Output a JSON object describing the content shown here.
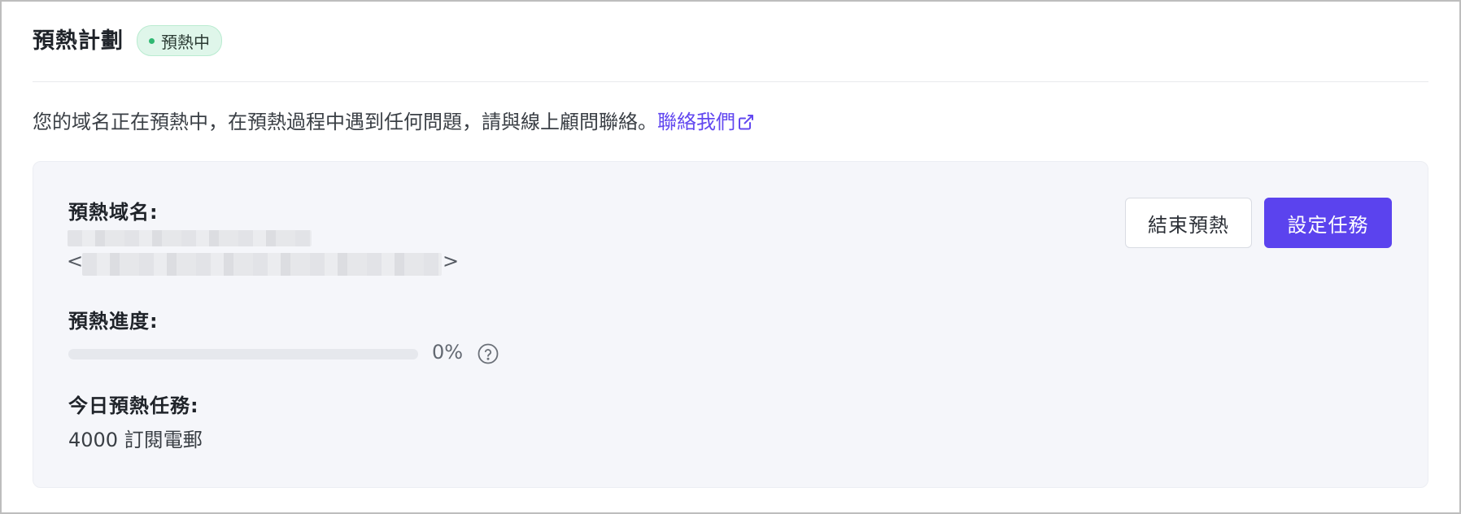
{
  "header": {
    "title": "預熱計劃",
    "status_badge": "預熱中",
    "status_color": "#2fb872"
  },
  "notice": {
    "text": "您的域名正在預熱中，在預熱過程中遇到任何問題，請與線上顧問聯絡。",
    "link_label": "聯絡我們",
    "link_icon": "external-link-icon"
  },
  "panel": {
    "domain_label": "預熱域名:",
    "domain_bracket_open": "<",
    "domain_bracket_close": ">",
    "progress_label": "預熱進度:",
    "progress_percent": 0,
    "progress_text": "0%",
    "help_icon": "question-circle-icon",
    "tasks_label": "今日預熱任務:",
    "tasks_value": "4000 訂閱電郵",
    "end_button": "結束預熱",
    "setup_button": "設定任務"
  },
  "colors": {
    "accent": "#5b43ee",
    "panel_bg": "#f5f6fa",
    "badge_bg": "#dff6ea"
  }
}
